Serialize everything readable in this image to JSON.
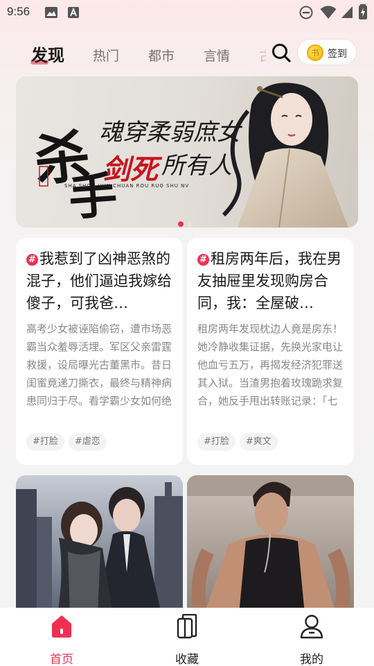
{
  "status_bar": {
    "time": "9:56"
  },
  "nav": {
    "tabs": [
      "发现",
      "热门",
      "都市",
      "言情",
      "古"
    ],
    "active_index": 0,
    "checkin_label": "签到",
    "coin_glyph": "书"
  },
  "banner": {
    "title_art": "杀手魂穿柔弱庶女 剑死所有人",
    "pinyin": "SHA SHOU HUN CHUAN ROU RUO SHU NV",
    "slide_count": 2,
    "active_slide": 0
  },
  "cards": [
    {
      "badge": "#",
      "title": "我惹到了凶神恶煞的混子，他们逼迫我嫁给傻子，可我爸…",
      "description": "高考少女被诬陷偷窃，遭市场恶霸当众羞辱活埋。军区父亲雷霆救援，设局曝光古董黑市。昔日闺蜜竟递刀撕衣，最终与精神病患同归于尽。看学霸少女如何绝地反杀，让百…",
      "tags": [
        "#打脸",
        "#虐恋"
      ]
    },
    {
      "badge": "#",
      "title": "租房两年后，我在男友抽屉里发现购房合同，我：全屋破…",
      "description": "租房两年发现枕边人竟是房东！她冷静收集证据，先换光家电让他血亏五万，再揭发经济犯罪送其入狱。当渣男抱着玫瑰跪求复合，她反手甩出转账记录：「七万租金和牢饭…",
      "tags": [
        "#打脸",
        "#爽文"
      ]
    }
  ],
  "bottom_nav": [
    {
      "label": "首页",
      "icon": "home-icon",
      "active": true
    },
    {
      "label": "收藏",
      "icon": "bookshelf-icon",
      "active": false
    },
    {
      "label": "我的",
      "icon": "profile-icon",
      "active": false
    }
  ],
  "colors": {
    "accent": "#ef3052",
    "coin": "#f5b700"
  }
}
